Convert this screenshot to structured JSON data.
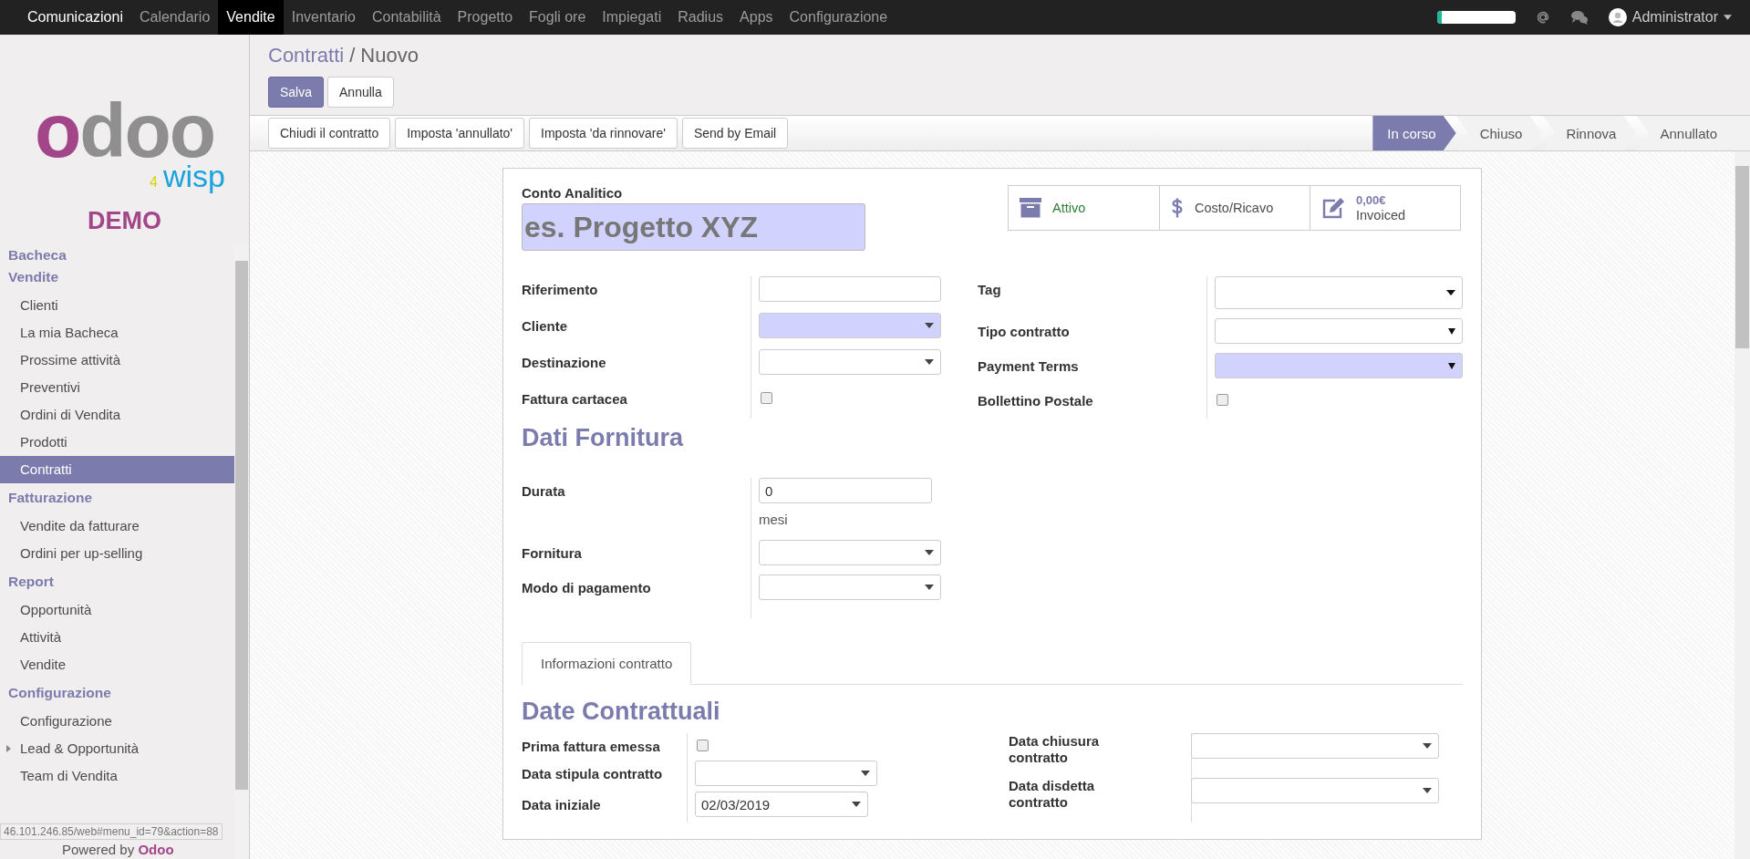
{
  "navbar": {
    "apps": [
      {
        "label": "Comunicazioni",
        "selected": false
      },
      {
        "label": "Calendario",
        "selected": false
      },
      {
        "label": "Vendite",
        "selected": true
      },
      {
        "label": "Inventario",
        "selected": false
      },
      {
        "label": "Contabilità",
        "selected": false
      },
      {
        "label": "Progetto",
        "selected": false
      },
      {
        "label": "Fogli ore",
        "selected": false
      },
      {
        "label": "Impiegati",
        "selected": false
      },
      {
        "label": "Radius",
        "selected": false
      },
      {
        "label": "Apps",
        "selected": false
      },
      {
        "label": "Configurazione",
        "selected": false
      }
    ],
    "progress": {
      "level": 0.06
    },
    "user": "Administrator"
  },
  "sidebar": {
    "logo": {
      "main": "odoo",
      "number": "4",
      "sub": "wisp"
    },
    "badge": "DEMO",
    "sections": [
      {
        "title": "Bacheca"
      },
      {
        "title": "Vendite",
        "items": [
          {
            "label": "Clienti",
            "selected": false
          },
          {
            "label": "La mia Bacheca",
            "selected": false
          },
          {
            "label": "Prossime attività",
            "selected": false
          },
          {
            "label": "Preventivi",
            "selected": false
          },
          {
            "label": "Ordini di Vendita",
            "selected": false
          },
          {
            "label": "Prodotti",
            "selected": false
          },
          {
            "label": "Contratti",
            "selected": true
          }
        ]
      },
      {
        "title": "Fatturazione",
        "items": [
          {
            "label": "Vendite da fatturare",
            "selected": false
          },
          {
            "label": "Ordini per up-selling",
            "selected": false
          }
        ]
      },
      {
        "title": "Report",
        "items": [
          {
            "label": "Opportunità",
            "selected": false
          },
          {
            "label": "Attività",
            "selected": false
          },
          {
            "label": "Vendite",
            "selected": false
          }
        ]
      },
      {
        "title": "Configurazione",
        "items": [
          {
            "label": "Configurazione",
            "selected": false,
            "expandable": false
          },
          {
            "label": "Lead & Opportunità",
            "selected": false,
            "expandable": true
          },
          {
            "label": "Team di Vendita",
            "selected": false,
            "expandable": false
          }
        ]
      }
    ],
    "powered_by": {
      "text": "Powered by",
      "brand": "Odoo"
    }
  },
  "status_url": "46.101.246.85/web#menu_id=79&action=88",
  "breadcrumb": {
    "parent": "Contratti",
    "separator": "/",
    "current": "Nuovo"
  },
  "buttons": [
    {
      "label": "Salva",
      "kind": "primary"
    },
    {
      "label": "Annulla",
      "kind": "default"
    }
  ],
  "actions": [
    "Chiudi il contratto",
    "Imposta 'annullato'",
    "Imposta 'da rinnovare'",
    "Send by Email"
  ],
  "stages": [
    {
      "label": "In corso",
      "selected": true
    },
    {
      "label": "Chiuso",
      "selected": false
    },
    {
      "label": "Rinnova",
      "selected": false
    },
    {
      "label": "Annullato",
      "selected": false
    }
  ],
  "form": {
    "title_label": "Conto Analitico",
    "title_placeholder": "es. Progetto XYZ",
    "smart_buttons": [
      {
        "kind": "archive",
        "label": "Attivo"
      },
      {
        "kind": "money",
        "label": "Costo/Ricavo"
      },
      {
        "kind": "invoice",
        "value": "0,00€",
        "label": "Invoiced"
      }
    ],
    "left_fields": [
      {
        "label": "Riferimento",
        "kind": "text",
        "required": false
      },
      {
        "label": "Cliente",
        "kind": "select",
        "required": true
      },
      {
        "label": "Destinazione",
        "kind": "select",
        "required": false
      },
      {
        "label": "Fattura cartacea",
        "kind": "checkbox",
        "checked": false
      }
    ],
    "right_fields": [
      {
        "label": "Tag",
        "kind": "tags",
        "required": false
      },
      {
        "label": "Tipo contratto",
        "kind": "native",
        "required": false
      },
      {
        "label": "Payment Terms",
        "kind": "native",
        "required": true
      },
      {
        "label": "Bollettino Postale",
        "kind": "checkbox",
        "checked": false
      }
    ],
    "supply": {
      "title": "Dati Fornitura",
      "fields": [
        {
          "label": "Durata",
          "kind": "text",
          "required": false,
          "value": "0",
          "unit": "mesi"
        },
        {
          "label": "Fornitura",
          "kind": "select",
          "required": false
        },
        {
          "label": "Modo di pagamento",
          "kind": "select",
          "required": false
        }
      ]
    },
    "tabs": [
      {
        "label": "Informazioni contratto",
        "selected": true
      }
    ],
    "dates": {
      "title": "Date Contrattuali",
      "left_fields": [
        {
          "label": "Prima fattura emessa",
          "kind": "checkbox",
          "checked": false
        },
        {
          "label": "Data stipula contratto",
          "kind": "select",
          "required": false
        },
        {
          "label": "Data iniziale",
          "kind": "select",
          "required": false,
          "value": "02/03/2019"
        }
      ],
      "right_fields": [
        {
          "label": "Data chiusura contratto",
          "kind": "select",
          "required": false
        },
        {
          "label": "Data disdetta contratto",
          "kind": "select",
          "required": false
        }
      ]
    }
  }
}
